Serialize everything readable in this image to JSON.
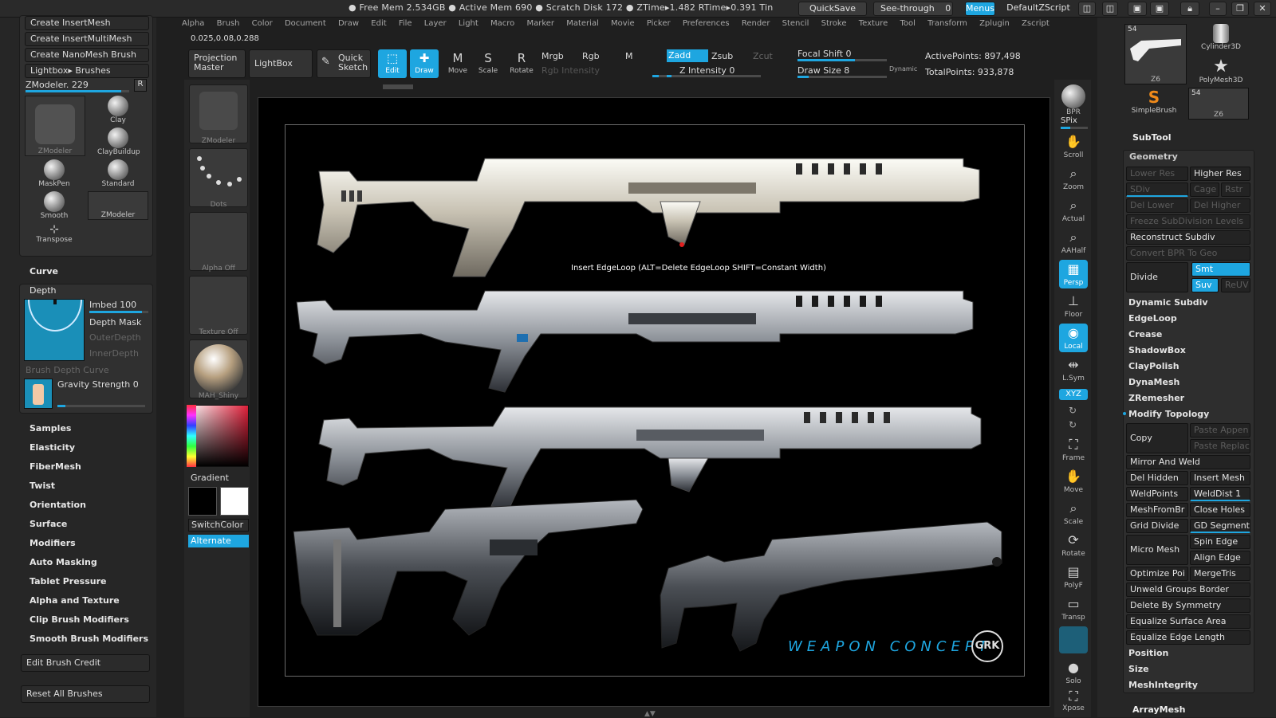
{
  "top": {
    "status": "● Free Mem 2.534GB ● Active Mem 690 ● Scratch Disk 172 ● ZTime▸1.482 RTime▸0.391 Tin",
    "quicksave": "QuickSave",
    "seethrough": "See-through",
    "seethrough_val": "0",
    "menus": "Menus",
    "script": "DefaultZScript"
  },
  "menubar": [
    "Alpha",
    "Brush",
    "Color",
    "Document",
    "Draw",
    "Edit",
    "File",
    "Layer",
    "Light",
    "Macro",
    "Marker",
    "Material",
    "Movie",
    "Picker",
    "Preferences",
    "Render",
    "Stencil",
    "Stroke",
    "Texture",
    "Tool",
    "Transform",
    "Zplugin",
    "Zscript"
  ],
  "coords": "0.025,0.08,0.288",
  "toolbar": {
    "projection_master": "Projection Master",
    "lightbox": "LightBox",
    "quick_sketch": "Quick Sketch",
    "tools": [
      "Edit",
      "Draw",
      "Move",
      "Scale",
      "Rotate"
    ],
    "mrgb": "Mrgb",
    "rgb": "Rgb",
    "m": "M",
    "zadd": "Zadd",
    "zsub": "Zsub",
    "zcut": "Zcut",
    "rgb_intensity": "Rgb Intensity",
    "z_intensity": "Z Intensity 0",
    "focal_shift": "Focal Shift 0",
    "draw_size": "Draw Size 8",
    "dynamic": "Dynamic",
    "active_points": "ActivePoints: 897,498",
    "total_points": "TotalPoints: 933,878"
  },
  "left": {
    "buttons": [
      "Create InsertMesh",
      "Create InsertMultiMesh",
      "Create NanoMesh Brush",
      "Lightbox▸ Brushes"
    ],
    "zmodeler_label": "ZModeler. 229",
    "r": "R",
    "brushes": [
      "ZModeler",
      "Clay",
      "ClayBuildup",
      "MaskPen",
      "Standard",
      "Smooth",
      "ZModeler",
      "Transpose"
    ],
    "curve": "Curve",
    "depth": "Depth",
    "imbed": "Imbed 100",
    "depth_mask": "Depth Mask",
    "outer_depth": "OuterDepth",
    "inner_depth": "InnerDepth",
    "brush_depth_curve": "Brush Depth Curve",
    "gravity": "Gravity Strength 0",
    "menu": [
      "Samples",
      "Elasticity",
      "FiberMesh",
      "Twist",
      "Orientation",
      "Surface",
      "Modifiers",
      "Auto Masking",
      "Tablet Pressure",
      "Alpha and Texture",
      "Clip Brush Modifiers",
      "Smooth Brush Modifiers"
    ],
    "edit_credit": "Edit Brush Credit",
    "reset": "Reset All Brushes"
  },
  "tray": {
    "labels": [
      "ZModeler",
      "Dots",
      "Alpha Off",
      "Texture Off",
      "MAH_Shiny"
    ],
    "gradient": "Gradient",
    "switchcolor": "SwitchColor",
    "alternate": "Alternate"
  },
  "canvas": {
    "hint": "Insert EdgeLoop (ALT=Delete EdgeLoop SHIFT=Constant Width)",
    "weapon_text": "WEAPON CONCEPT",
    "logo": "GRK"
  },
  "right_tools": [
    "BPR",
    "SPix",
    "Scroll",
    "Zoom",
    "Actual",
    "AAHalf",
    "Persp",
    "Floor",
    "Local",
    "L.Sym",
    "XYZ",
    "Frame",
    "Move",
    "Scale",
    "Rotate",
    "PolyF",
    "Transp",
    "Solo",
    "Xpose"
  ],
  "rp": {
    "thumbs": [
      {
        "n": "54",
        "label": "Z6"
      },
      {
        "label": "Cylinder3D"
      },
      {
        "label": "PolyMesh3D"
      },
      {
        "label": "SimpleBrush"
      },
      {
        "n": "54",
        "label": "Z6"
      }
    ],
    "subtool": "SubTool",
    "geometry": "Geometry",
    "rows": [
      [
        "Lower Res",
        "Higher Res"
      ],
      [
        "SDiv",
        "Cage",
        "Rstr"
      ],
      [
        "Del Lower",
        "Del Higher"
      ],
      [
        "Freeze SubDivision Levels"
      ],
      [
        "Reconstruct Subdiv"
      ],
      [
        "Convert BPR To Geo"
      ]
    ],
    "divide": "Divide",
    "smt": "Smt",
    "suv": "Suv",
    "reuv": "ReUV",
    "items1": [
      "Dynamic Subdiv",
      "EdgeLoop",
      "Crease",
      "ShadowBox",
      "ClayPolish",
      "DynaMesh",
      "ZRemesher"
    ],
    "modify": "Modify Topology",
    "copy": "Copy",
    "paste_append": "Paste Appen",
    "paste_replace": "Paste Replac",
    "mirror_weld": "Mirror And Weld",
    "grid": [
      [
        "Del Hidden",
        "Insert Mesh"
      ],
      [
        "WeldPoints",
        "WeldDist 1"
      ],
      [
        "MeshFromBr",
        "Close Holes"
      ],
      [
        "Grid Divide",
        "GD Segments"
      ]
    ],
    "micro_mesh": "Micro Mesh",
    "spin_edge": "Spin Edge",
    "align_edge": "Align Edge",
    "optimize": "Optimize Poi",
    "mergetris": "MergeTris",
    "wide": [
      "Unweld Groups Border",
      "Delete By Symmetry",
      "Equalize Surface Area",
      "Equalize Edge Length"
    ],
    "items2": [
      "Position",
      "Size",
      "MeshIntegrity"
    ],
    "arraymesh": "ArrayMesh"
  }
}
